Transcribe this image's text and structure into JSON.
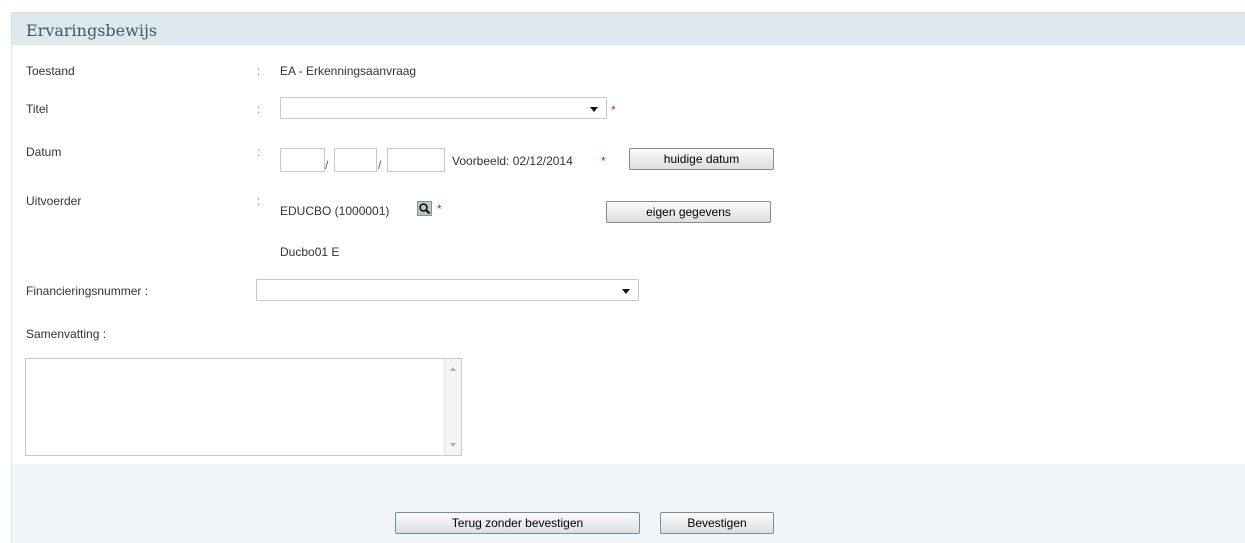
{
  "panel": {
    "title": "Ervaringsbewijs"
  },
  "form": {
    "toestand": {
      "label": "Toestand",
      "value": "EA - Erkenningsaanvraag"
    },
    "titel": {
      "label": "Titel",
      "value": "",
      "required_mark": "*"
    },
    "datum": {
      "label": "Datum",
      "day": "",
      "month": "",
      "year": "",
      "separator": "/",
      "example": "Voorbeeld: 02/12/2014",
      "required_mark": "*",
      "today_button": "huidige datum"
    },
    "uitvoerder": {
      "label": "Uitvoerder",
      "value": "EDUCBO (1000001)",
      "search_icon": "search-icon",
      "required_mark": "*",
      "own_data_button": "eigen gegevens",
      "name": "Ducbo01 E"
    },
    "financiering": {
      "label": "Financieringsnummer :",
      "value": ""
    },
    "samenvatting": {
      "label": "Samenvatting :",
      "value": ""
    },
    "colon": ":"
  },
  "actions": {
    "back_label": "Terug zonder bevestigen",
    "confirm_label": "Bevestigen"
  }
}
